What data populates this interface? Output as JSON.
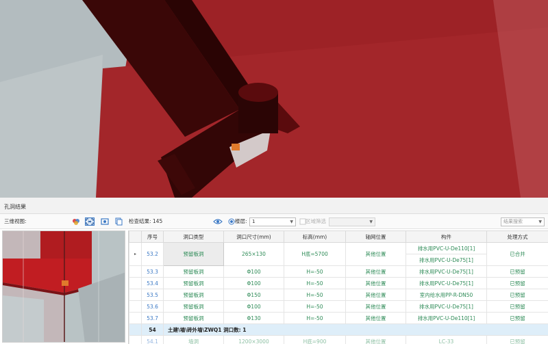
{
  "panel": {
    "title": "孔洞结果"
  },
  "toolbar": {
    "view_label": "三维视图:",
    "result_text": "检查结果: 145",
    "floor_label": "楼层:",
    "floor_value": "1",
    "region_filter": "区域筛选",
    "search_placeholder": "结果搜索"
  },
  "table": {
    "headers": [
      "序号",
      "洞口类型",
      "洞口尺寸(mm)",
      "标高(mm)",
      "轴网位置",
      "构件",
      "处理方式"
    ],
    "rows": [
      {
        "seq": "53.2",
        "type": "预留板洞",
        "size": "265×130",
        "elev": "H底=5700",
        "axis": "其他位置",
        "comp1": "排水用PVC-U-De110[1]",
        "comp2": "排水用PVC-U-De75[1]",
        "method": "已合并"
      },
      {
        "seq": "53.3",
        "type": "预留板洞",
        "size": "Φ100",
        "elev": "H=-50",
        "axis": "其他位置",
        "comp": "排水用PVC-U-De75[1]",
        "method": "已预留"
      },
      {
        "seq": "53.4",
        "type": "预留板洞",
        "size": "Φ100",
        "elev": "H=-50",
        "axis": "其他位置",
        "comp": "排水用PVC-U-De75[1]",
        "method": "已预留"
      },
      {
        "seq": "53.5",
        "type": "预留板洞",
        "size": "Φ150",
        "elev": "H=-50",
        "axis": "其他位置",
        "comp": "室内给水用PP-R-DN50",
        "method": "已预留"
      },
      {
        "seq": "53.6",
        "type": "预留板洞",
        "size": "Φ100",
        "elev": "H=-50",
        "axis": "其他位置",
        "comp": "排水用PVC-U-De75[1]",
        "method": "已预留"
      },
      {
        "seq": "53.7",
        "type": "预留板洞",
        "size": "Φ130",
        "elev": "H=-50",
        "axis": "其他位置",
        "comp": "排水用PVC-U-De110[1]",
        "method": "已预留"
      }
    ],
    "group": {
      "num": "54",
      "text": "土建\\墙\\砖外墙\\ZWQ1  洞口数: 1"
    },
    "last_row": {
      "seq": "54.1",
      "type": "墙洞",
      "size": "1200×3000",
      "elev": "H底=900",
      "axis": "其他位置",
      "comp": "LC-33",
      "method": "已预留"
    }
  },
  "colors": {
    "accent": "#3a78c5",
    "green_text": "#2e8b57",
    "group_bg": "#deeef9",
    "model_red": "#9d2226"
  },
  "icons": [
    "color-icon",
    "fit-view-icon",
    "camera-icon",
    "copy-icon",
    "eye-icon",
    "chevron-down-icon",
    "row-indicator-icon"
  ]
}
